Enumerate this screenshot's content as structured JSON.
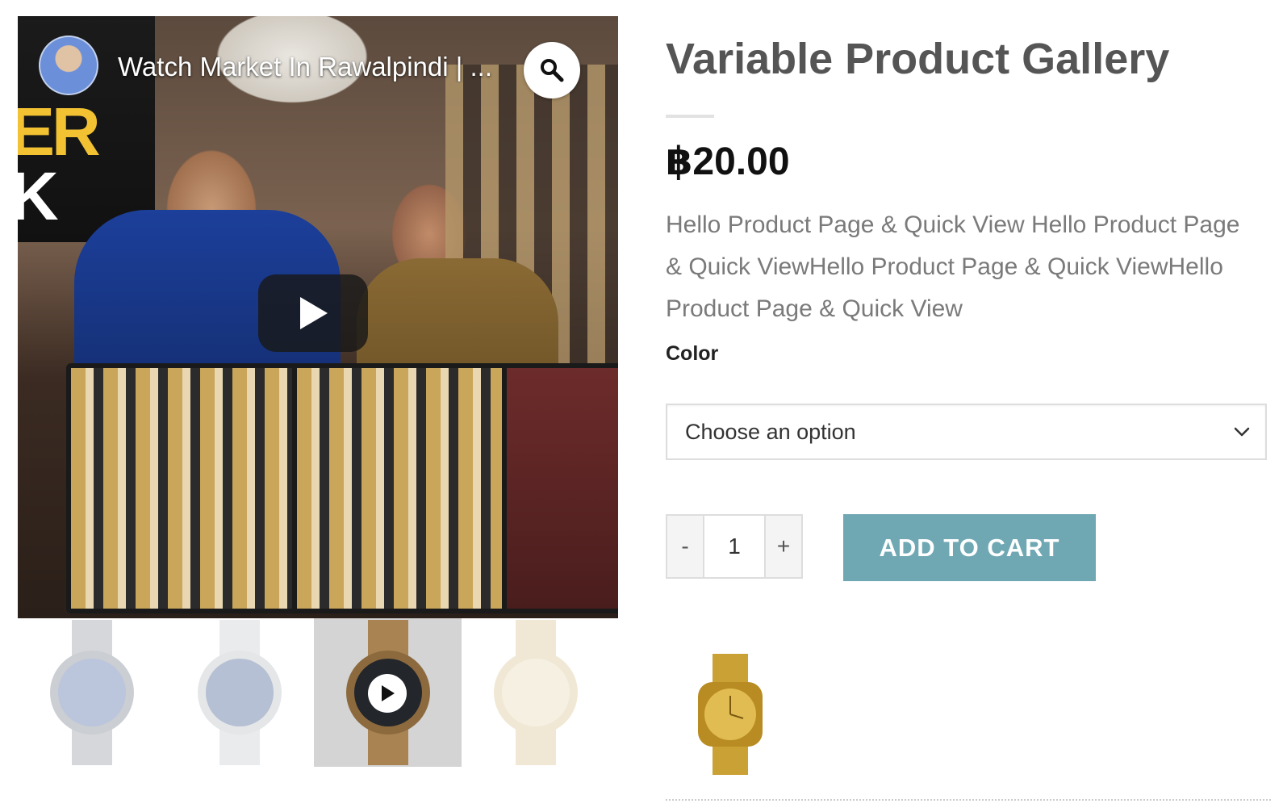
{
  "product": {
    "title": "Variable Product Gallery",
    "price": "฿20.00",
    "description": "Hello Product Page & Quick View Hello Product Page & Quick ViewHello Product Page & Quick ViewHello Product Page & Quick View"
  },
  "variation": {
    "label": "Color",
    "selected": "Choose an option"
  },
  "quantity": {
    "minus": "-",
    "value": "1",
    "plus": "+"
  },
  "cart": {
    "button_label": "ADD TO CART",
    "button_color": "#6fa8b3"
  },
  "video": {
    "title": "Watch Market In Rawalpindi | ...",
    "overlay_text_1": "ER",
    "overlay_text_2": "K",
    "zoom_icon": "search-icon",
    "play_icon": "play-icon"
  },
  "gallery": {
    "thumbnails": [
      {
        "icon": "watch-silver-mesh-icon"
      },
      {
        "icon": "watch-silver-icon"
      },
      {
        "icon": "watch-gold-video-icon",
        "active": true
      },
      {
        "icon": "watch-gold-icon"
      }
    ]
  },
  "colors": {
    "title": "#555555",
    "description": "#7a7a7a",
    "thumb_active_bg": "#d4d4d4"
  }
}
